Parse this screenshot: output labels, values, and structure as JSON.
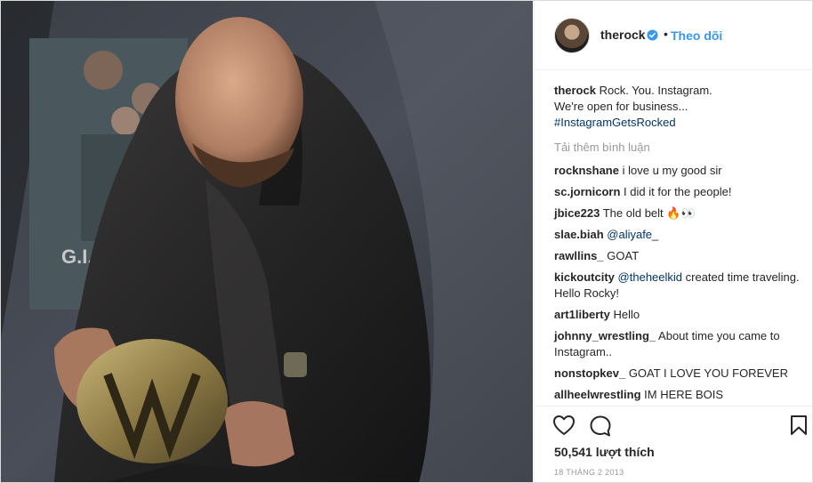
{
  "post": {
    "username": "therock",
    "follow_label": "Theo dõi",
    "separator": "•",
    "caption": {
      "user": "therock",
      "line1": "Rock. You. Instagram.",
      "line2": "We're open for business...",
      "hashtag": "#InstagramGetsRocked"
    },
    "load_more": "Tải thêm bình luận",
    "comments": [
      {
        "user": "rocknshane",
        "text": "i love u my good sir"
      },
      {
        "user": "sc.jornicorn",
        "text": "I did it for the people!"
      },
      {
        "user": "jbice223",
        "text": "The old belt 🔥👀"
      },
      {
        "user": "slae.biah",
        "mention": "@aliyafe_",
        "text": ""
      },
      {
        "user": "rawllins_",
        "text": "GOAT"
      },
      {
        "user": "kickoutcity",
        "mention": "@theheelkid",
        "text": "created time traveling. Hello Rocky!"
      },
      {
        "user": "art1liberty",
        "text": "Hello"
      },
      {
        "user": "johnny_wrestling_",
        "text": "About time you came to Instagram.."
      },
      {
        "user": "nonstopkev_",
        "text": "GOAT I LOVE YOU FOREVER"
      },
      {
        "user": "allheelwrestling",
        "text": "IM HERE BOIS"
      }
    ],
    "likes": "50,541 lượt thích",
    "date": "18 THÁNG 2 2013"
  },
  "poster_text": "G.I.J",
  "icons": {
    "verified": "verified-badge-icon",
    "like": "heart-icon",
    "comment": "comment-bubble-icon",
    "save": "bookmark-icon"
  },
  "colors": {
    "accent": "#3897f0",
    "link": "#003569",
    "muted": "#999999"
  }
}
